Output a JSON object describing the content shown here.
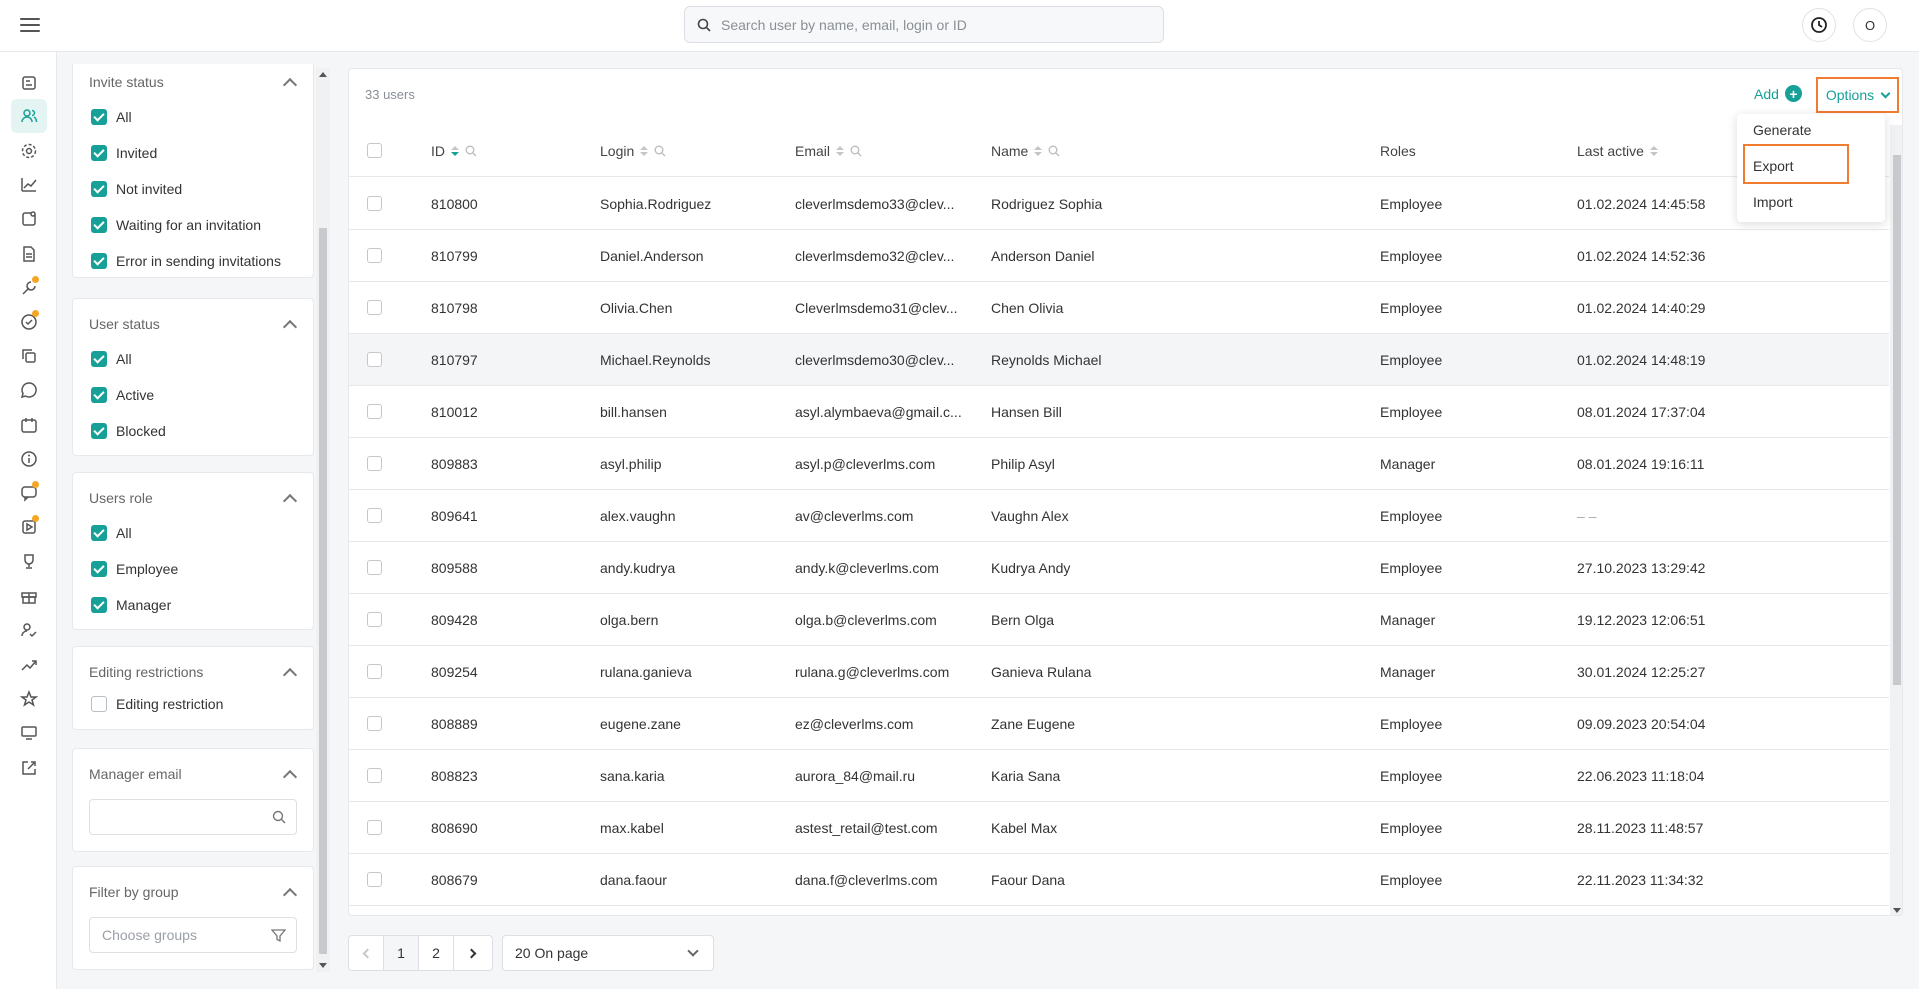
{
  "header": {
    "search_placeholder": "Search user by name, email, login or ID",
    "avatar_initial": "O"
  },
  "filters": {
    "invite_status": {
      "title": "Invite status",
      "options": [
        {
          "label": "All",
          "checked": true
        },
        {
          "label": "Invited",
          "checked": true
        },
        {
          "label": "Not invited",
          "checked": true
        },
        {
          "label": "Waiting for an invitation",
          "checked": true
        },
        {
          "label": "Error in sending invitations",
          "checked": true
        }
      ]
    },
    "user_status": {
      "title": "User status",
      "options": [
        {
          "label": "All",
          "checked": true
        },
        {
          "label": "Active",
          "checked": true
        },
        {
          "label": "Blocked",
          "checked": true
        }
      ]
    },
    "users_role": {
      "title": "Users role",
      "options": [
        {
          "label": "All",
          "checked": true
        },
        {
          "label": "Employee",
          "checked": true
        },
        {
          "label": "Manager",
          "checked": true
        }
      ]
    },
    "editing_restrictions": {
      "title": "Editing restrictions",
      "options": [
        {
          "label": "Editing restriction",
          "checked": false
        }
      ]
    },
    "manager_email": {
      "title": "Manager email",
      "placeholder": ""
    },
    "filter_by_group": {
      "title": "Filter by group",
      "placeholder": "Choose groups"
    }
  },
  "main": {
    "count": "33 users",
    "add_label": "Add",
    "options_label": "Options",
    "options_menu": [
      "Generate",
      "Export",
      "Import"
    ],
    "columns": {
      "id": "ID",
      "login": "Login",
      "email": "Email",
      "name": "Name",
      "roles": "Roles",
      "last_active": "Last active"
    },
    "rows": [
      {
        "id": "810800",
        "login": "Sophia.Rodriguez",
        "email": "cleverlmsdemo33@clev...",
        "name": "Rodriguez Sophia",
        "role": "Employee",
        "last_active": "01.02.2024 14:45:58"
      },
      {
        "id": "810799",
        "login": "Daniel.Anderson",
        "email": "cleverlmsdemo32@clev...",
        "name": "Anderson Daniel",
        "role": "Employee",
        "last_active": "01.02.2024 14:52:36"
      },
      {
        "id": "810798",
        "login": "Olivia.Chen",
        "email": "Cleverlmsdemo31@clev...",
        "name": "Chen Olivia",
        "role": "Employee",
        "last_active": "01.02.2024 14:40:29"
      },
      {
        "id": "810797",
        "login": "Michael.Reynolds",
        "email": "cleverlmsdemo30@clev...",
        "name": "Reynolds Michael",
        "role": "Employee",
        "last_active": "01.02.2024 14:48:19"
      },
      {
        "id": "810012",
        "login": "bill.hansen",
        "email": "asyl.alymbaeva@gmail.c...",
        "name": "Hansen Bill",
        "role": "Employee",
        "last_active": "08.01.2024 17:37:04"
      },
      {
        "id": "809883",
        "login": "asyl.philip",
        "email": "asyl.p@cleverlms.com",
        "name": "Philip Asyl",
        "role": "Manager",
        "last_active": "08.01.2024 19:16:11"
      },
      {
        "id": "809641",
        "login": "alex.vaughn",
        "email": "av@cleverlms.com",
        "name": "Vaughn Alex",
        "role": "Employee",
        "last_active": "– –"
      },
      {
        "id": "809588",
        "login": "andy.kudrya",
        "email": "andy.k@cleverlms.com",
        "name": "Kudrya Andy",
        "role": "Employee",
        "last_active": "27.10.2023 13:29:42"
      },
      {
        "id": "809428",
        "login": "olga.bern",
        "email": "olga.b@cleverlms.com",
        "name": "Bern Olga",
        "role": "Manager",
        "last_active": "19.12.2023 12:06:51"
      },
      {
        "id": "809254",
        "login": "rulana.ganieva",
        "email": "rulana.g@cleverlms.com",
        "name": "Ganieva Rulana",
        "role": "Manager",
        "last_active": "30.01.2024 12:25:27"
      },
      {
        "id": "808889",
        "login": "eugene.zane",
        "email": "ez@cleverlms.com",
        "name": "Zane Eugene",
        "role": "Employee",
        "last_active": "09.09.2023 20:54:04"
      },
      {
        "id": "808823",
        "login": "sana.karia",
        "email": "aurora_84@mail.ru",
        "name": "Karia Sana",
        "role": "Employee",
        "last_active": "22.06.2023 11:18:04"
      },
      {
        "id": "808690",
        "login": "max.kabel",
        "email": "astest_retail@test.com",
        "name": "Kabel Max",
        "role": "Employee",
        "last_active": "28.11.2023 11:48:57"
      },
      {
        "id": "808679",
        "login": "dana.faour",
        "email": "dana.f@cleverlms.com",
        "name": "Faour Dana",
        "role": "Employee",
        "last_active": "22.11.2023 11:34:32"
      }
    ]
  },
  "pagination": {
    "pages": [
      "1",
      "2"
    ],
    "per_page": "20 On page"
  },
  "colors": {
    "accent": "#17a097",
    "highlight": "#f07c32"
  }
}
